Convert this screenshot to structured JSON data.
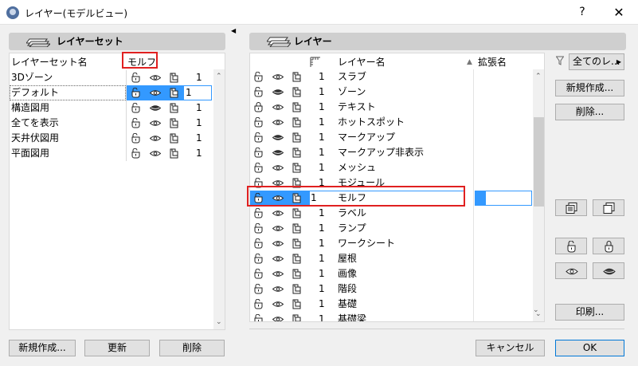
{
  "window": {
    "title": "レイヤー(モデルビュー)",
    "help": "?",
    "close": "✕"
  },
  "layer_sets": {
    "header": "レイヤーセット",
    "column_name": "レイヤーセット名",
    "column_sel": "モルフ",
    "rows": [
      {
        "name": "3Dゾーン",
        "num": "1"
      },
      {
        "name": "デフォルト",
        "num": "1"
      },
      {
        "name": "構造図用",
        "num": "1"
      },
      {
        "name": "全てを表示",
        "num": "1"
      },
      {
        "name": "天井伏図用",
        "num": "1"
      },
      {
        "name": "平面図用",
        "num": "1"
      }
    ],
    "buttons": {
      "new": "新規作成...",
      "update": "更新",
      "delete": "削除"
    }
  },
  "layers": {
    "header": "レイヤー",
    "col_name": "レイヤー名",
    "col_ext": "拡張名",
    "sort_indicator": "▲",
    "rows": [
      {
        "num": "1",
        "name": "スラブ",
        "icons": [
          "unlock-icon",
          "eye-icon",
          "pages-icon"
        ]
      },
      {
        "num": "1",
        "name": "ゾーン",
        "icons": [
          "unlock-icon",
          "eye-closed-icon",
          "pages-icon"
        ]
      },
      {
        "num": "1",
        "name": "テキスト",
        "icons": [
          "lock-icon",
          "eye-icon",
          "pages-icon"
        ]
      },
      {
        "num": "1",
        "name": "ホットスポット",
        "icons": [
          "unlock-icon",
          "eye-icon",
          "pages-icon"
        ]
      },
      {
        "num": "1",
        "name": "マークアップ",
        "icons": [
          "unlock-icon",
          "eye-closed-icon",
          "pages-icon"
        ]
      },
      {
        "num": "1",
        "name": "マークアップ非表示",
        "icons": [
          "unlock-icon",
          "eye-closed-icon",
          "pages-icon"
        ]
      },
      {
        "num": "1",
        "name": "メッシュ",
        "icons": [
          "unlock-icon",
          "eye-icon",
          "pages-icon"
        ]
      },
      {
        "num": "1",
        "name": "モジュール",
        "icons": [
          "unlock-icon",
          "eye-icon",
          "pages-icon"
        ]
      },
      {
        "num": "1",
        "name": "モルフ",
        "icons": [
          "unlock-icon",
          "eye-icon",
          "pages-icon"
        ]
      },
      {
        "num": "1",
        "name": "ラベル",
        "icons": [
          "unlock-icon",
          "eye-icon",
          "pages-icon"
        ]
      },
      {
        "num": "1",
        "name": "ランプ",
        "icons": [
          "unlock-icon",
          "eye-icon",
          "pages-icon"
        ]
      },
      {
        "num": "1",
        "name": "ワークシート",
        "icons": [
          "unlock-icon",
          "eye-icon",
          "pages-icon"
        ]
      },
      {
        "num": "1",
        "name": "屋根",
        "icons": [
          "unlock-icon",
          "eye-icon",
          "pages-icon"
        ]
      },
      {
        "num": "1",
        "name": "画像",
        "icons": [
          "unlock-icon",
          "eye-icon",
          "pages-icon"
        ]
      },
      {
        "num": "1",
        "name": "階段",
        "icons": [
          "unlock-icon",
          "eye-icon",
          "pages-icon"
        ]
      },
      {
        "num": "1",
        "name": "基礎",
        "icons": [
          "unlock-icon",
          "eye-icon",
          "pages-icon"
        ]
      },
      {
        "num": "1",
        "name": "基礎梁",
        "icons": [
          "unlock-icon",
          "eye-icon",
          "pages-icon"
        ]
      }
    ]
  },
  "right_controls": {
    "filter": "全てのレ...",
    "new": "新規作成...",
    "delete": "削除...",
    "print": "印刷..."
  },
  "footer": {
    "cancel": "キャンセル",
    "ok": "OK"
  },
  "colors": {
    "selection": "#cce8ff",
    "selection_border": "#3399ff",
    "ext_selected": "#3399ff",
    "highlight": "#e02020"
  }
}
